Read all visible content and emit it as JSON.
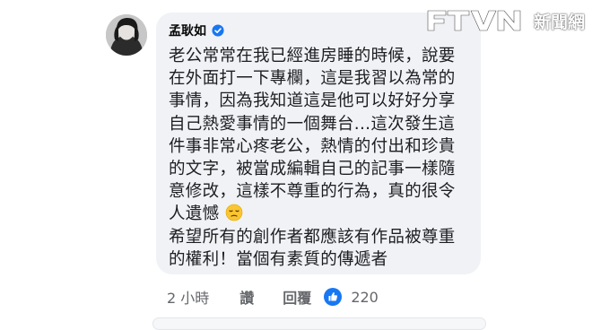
{
  "author": {
    "name": "孟耿如",
    "verified": true,
    "avatar_icon": "avatar-photo"
  },
  "comment": {
    "lines": [
      "老公常常在我已經進房睡的時候，說要",
      "在外面打一下專欄，這是我習以為常的",
      "事情，因為我知道這是他可以好好分享",
      "自己熱愛事情的一個舞台...這次發生這",
      "件事非常心疼老公，熱情的付出和珍貴",
      "的文字，被當成編輯自己的記事一樣隨",
      "意修改，這樣不尊重的行為，真的很令",
      "人遺憾",
      "希望所有的創作者都應該有作品被尊重",
      "的權利！當個有素質的傳遞者"
    ],
    "emoji": "pensive-face-icon"
  },
  "actions": {
    "time": "2 小時",
    "like": "讚",
    "reply": "回覆",
    "reaction_icon": "thumbs-up-icon",
    "reaction_count": "220"
  },
  "watermark": {
    "brand": "FTVN",
    "label": "新聞網"
  },
  "colors": {
    "bubble": "#f0f2f5",
    "verified": "#1877f2",
    "meta_text": "#65676b",
    "reaction": "#1877f2"
  }
}
